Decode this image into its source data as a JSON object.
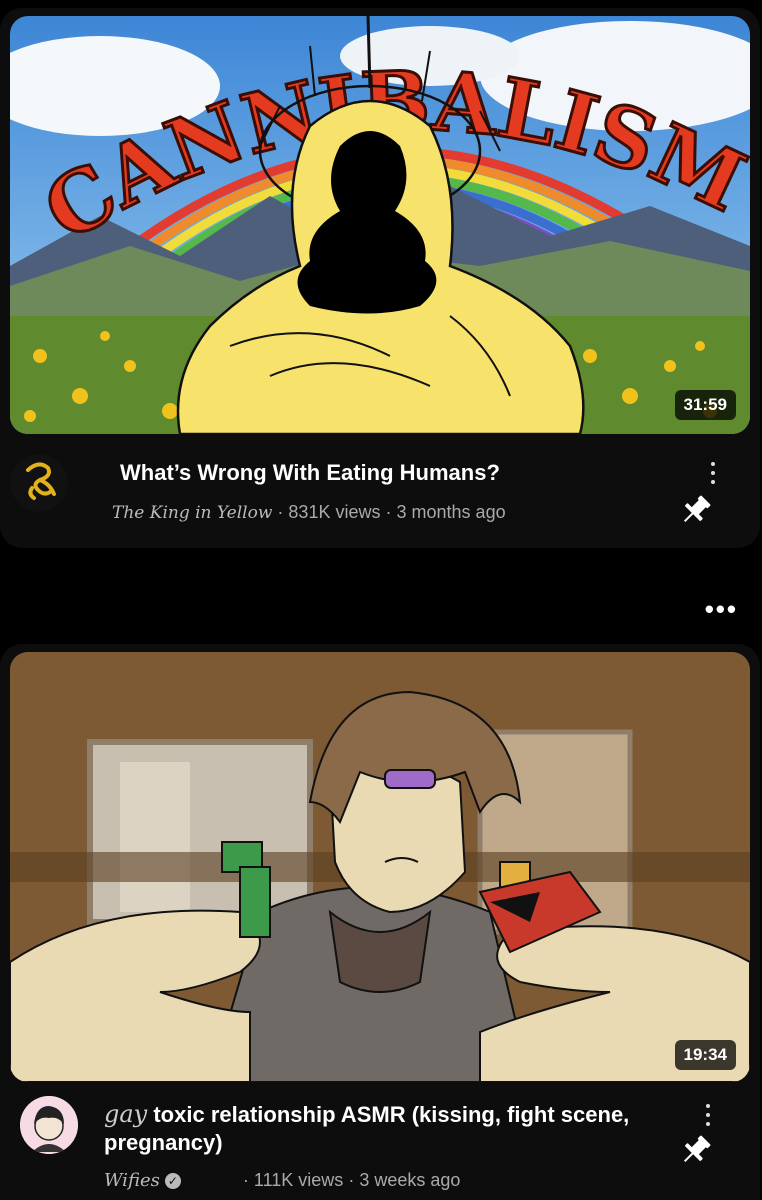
{
  "videos": [
    {
      "thumbnail_text": "CANNIBALISM",
      "duration": "31:59",
      "title": "What’s Wrong With Eating Humans?",
      "channel": "The King in Yellow",
      "views": "831K views",
      "age": "3 months ago",
      "separator": "·"
    },
    {
      "duration": "19:34",
      "title_prefix": "gay",
      "title": "toxic relationship ASMR (kissing, fight scene, pregnancy)",
      "channel": "Wifies",
      "views": "111K views",
      "age": "3 weeks ago",
      "separator": "·"
    }
  ],
  "between_menu": "•••",
  "colors": {
    "background": "#000000",
    "card": "#0d0d0d",
    "meta": "#aaaaaa",
    "accent_yellow": "#f7e36c"
  }
}
